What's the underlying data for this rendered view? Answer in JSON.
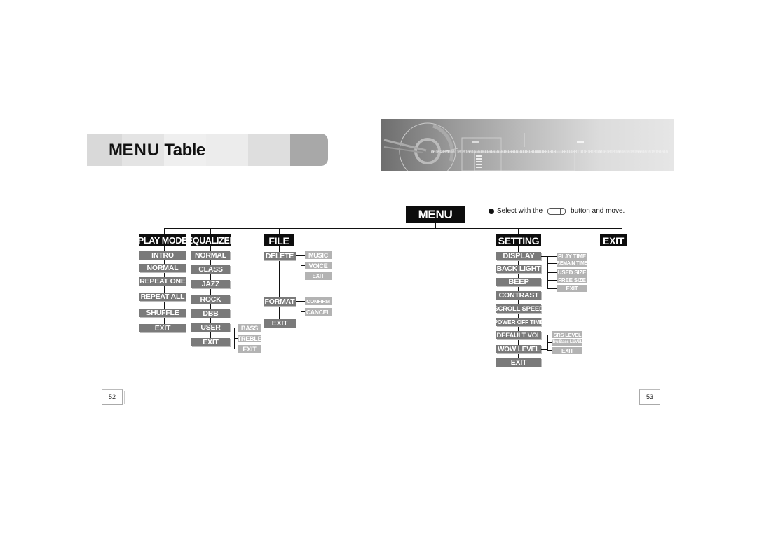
{
  "title": {
    "first": "M",
    "rest": "ENU",
    "second": "Table"
  },
  "header_graphic": {
    "binary_text": "0010101001011010100101010110101010101001010110101000100101011100111001101010101001010101001010101000101010101010"
  },
  "menu_root": "MENU",
  "hint": {
    "prefix": "Select with the",
    "suffix": "button and move.",
    "icon": "navigation-button-icon"
  },
  "categories": {
    "play_mode": {
      "label": "PLAY MODE",
      "items": [
        "INTRO",
        "NORMAL",
        "REPEAT ONE",
        "REPEAT ALL",
        "SHUFFLE",
        "EXIT"
      ]
    },
    "equalizer": {
      "label": "EQUALIZER",
      "items": [
        "NORMAL",
        "CLASS",
        "JAZZ",
        "ROCK",
        "DBB",
        "USER",
        "EXIT"
      ],
      "user_sub": [
        "BASS",
        "TREBLE",
        "EXIT"
      ]
    },
    "file": {
      "label": "FILE",
      "items": [
        "DELETE",
        "FORMAT",
        "EXIT"
      ],
      "delete_sub": [
        "MUSIC",
        "VOICE",
        "EXIT"
      ],
      "format_sub": [
        "CONFIRM",
        "CANCEL"
      ]
    },
    "setting": {
      "label": "SETTING",
      "items": [
        "DISPLAY",
        "BACK LIGHT",
        "BEEP",
        "CONTRAST",
        "SCROLL SPEED",
        "POWER OFF TIME",
        "DEFAULT VOL",
        "WOW LEVEL",
        "EXIT"
      ],
      "display_sub": [
        "PLAY TIME",
        "REMAIN TIME",
        "USED SIZE",
        "FREE SIZE",
        "EXIT"
      ],
      "wow_sub": [
        "SRS LEVEL",
        "Tru Bass LEVEL",
        "EXIT"
      ]
    },
    "exit": {
      "label": "EXIT"
    }
  },
  "page_numbers": {
    "left": "52",
    "right": "53"
  }
}
